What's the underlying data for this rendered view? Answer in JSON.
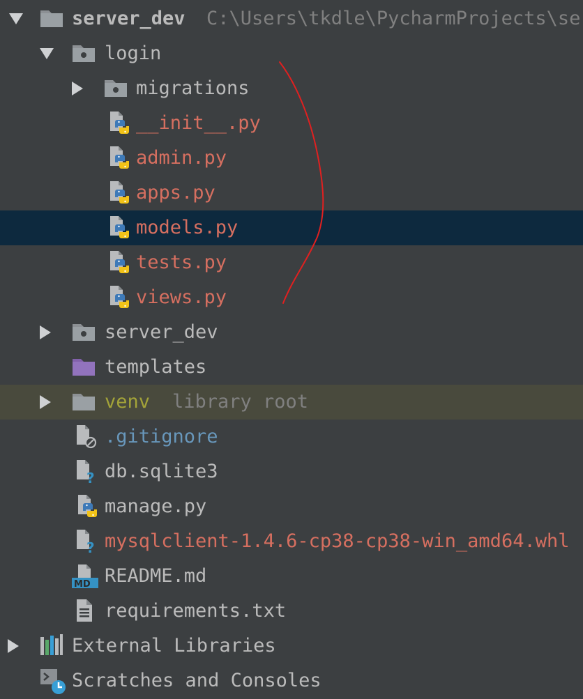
{
  "tree": {
    "root": {
      "label": "server_dev",
      "path": "C:\\Users\\tkdle\\PycharmProjects\\server_dev"
    },
    "login": {
      "label": "login"
    },
    "migrations": {
      "label": "migrations"
    },
    "login_files": [
      {
        "label": "__init__.py"
      },
      {
        "label": "admin.py"
      },
      {
        "label": "apps.py"
      },
      {
        "label": "models.py"
      },
      {
        "label": "tests.py"
      },
      {
        "label": "views.py"
      }
    ],
    "server_dev_pkg": {
      "label": "server_dev"
    },
    "templates": {
      "label": "templates"
    },
    "venv": {
      "label": "venv",
      "hint": "library root"
    },
    "gitignore": {
      "label": ".gitignore"
    },
    "db": {
      "label": "db.sqlite3"
    },
    "manage": {
      "label": "manage.py"
    },
    "whl": {
      "label": "mysqlclient-1.4.6-cp38-cp38-win_amd64.whl"
    },
    "readme": {
      "label": "README.md",
      "icon_text": "MD"
    },
    "requirements": {
      "label": "requirements.txt"
    },
    "external": {
      "label": "External Libraries"
    },
    "scratches": {
      "label": "Scratches and Consoles"
    }
  },
  "colors": {
    "background": "#3c3f41",
    "selection": "#0d293e",
    "library_root_row": "#494a3d",
    "modified_file": "#d66f60",
    "ignored_file": "#6897bb",
    "library_name": "#a3a339",
    "annotation": "#e02020"
  }
}
